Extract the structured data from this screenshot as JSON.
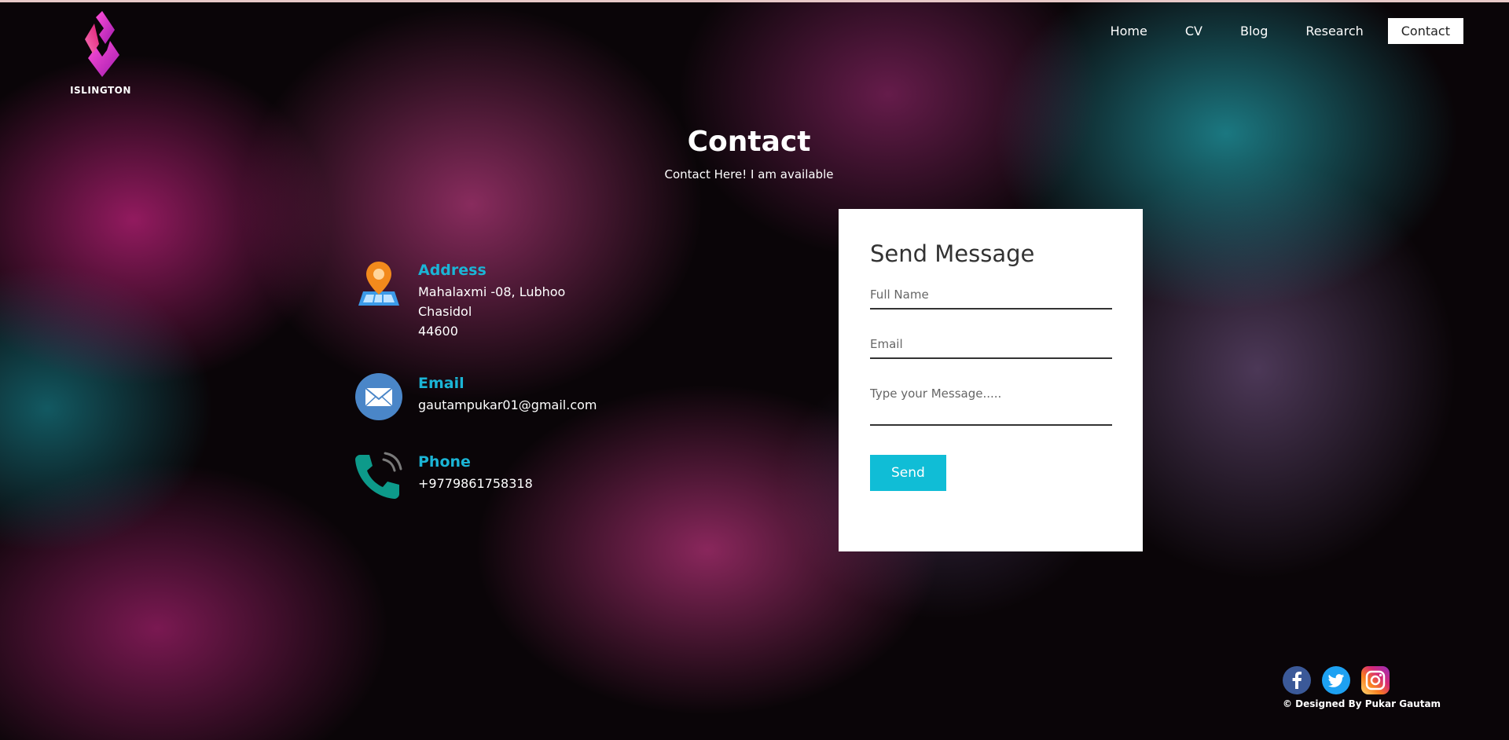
{
  "brand": {
    "name": "ISLINGTON",
    "logo_icon": "islington-logo-icon"
  },
  "nav": {
    "items": [
      {
        "label": "Home",
        "active": false
      },
      {
        "label": "CV",
        "active": false
      },
      {
        "label": "Blog",
        "active": false
      },
      {
        "label": "Research",
        "active": false
      },
      {
        "label": "Contact",
        "active": true
      }
    ]
  },
  "page": {
    "title": "Contact",
    "subtitle": "Contact Here! I am available"
  },
  "contact": {
    "address": {
      "title": "Address",
      "icon": "map-pin-icon",
      "lines": [
        "Mahalaxmi -08, Lubhoo",
        "Chasidol",
        "44600"
      ]
    },
    "email": {
      "title": "Email",
      "icon": "envelope-icon",
      "value": "gautampukar01@gmail.com"
    },
    "phone": {
      "title": "Phone",
      "icon": "phone-icon",
      "value": "+9779861758318"
    }
  },
  "form": {
    "title": "Send Message",
    "fullname_placeholder": "Full Name",
    "email_placeholder": "Email",
    "message_placeholder": "Type your Message.....",
    "send_label": "Send"
  },
  "footer": {
    "socials": [
      {
        "name": "facebook",
        "icon": "facebook-icon"
      },
      {
        "name": "twitter",
        "icon": "twitter-icon"
      },
      {
        "name": "instagram",
        "icon": "instagram-icon"
      }
    ],
    "credit": "© Designed By Pukar Gautam"
  },
  "colors": {
    "accent": "#10bdd6",
    "info_title": "#1bb5d6",
    "active_nav_bg": "#ffffff",
    "card_bg": "#ffffff"
  }
}
